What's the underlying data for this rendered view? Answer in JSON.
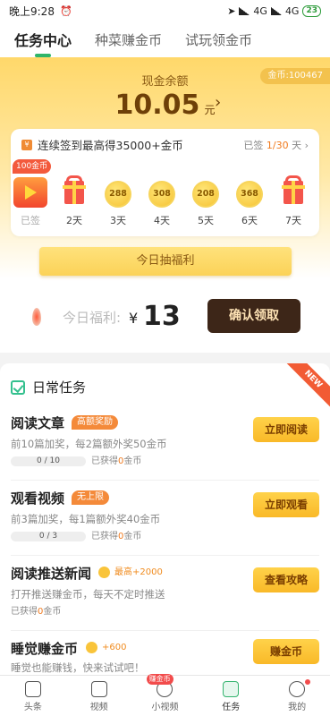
{
  "status_bar": {
    "time": "晚上9:28",
    "network": "4G",
    "network2": "4G",
    "battery": "23"
  },
  "top_tabs": [
    {
      "label": "任务中心",
      "active": true
    },
    {
      "label": "种菜赚金币",
      "active": false
    },
    {
      "label": "试玩领金币",
      "active": false
    }
  ],
  "hero": {
    "coin_tag": "金币:100467",
    "cash_label": "现金余额",
    "cash_value": "10.05",
    "cash_unit": "元"
  },
  "signin": {
    "title": "连续签到最高得35000+金币",
    "status_prefix": "已签",
    "status_count": "1/30",
    "status_suffix": "天 ›",
    "badge": "100金币",
    "days": [
      {
        "label": "已签",
        "reward": ""
      },
      {
        "label": "2天",
        "reward": ""
      },
      {
        "label": "3天",
        "reward": "288"
      },
      {
        "label": "4天",
        "reward": "308"
      },
      {
        "label": "5天",
        "reward": "208"
      },
      {
        "label": "6天",
        "reward": "368"
      },
      {
        "label": "7天",
        "reward": ""
      }
    ]
  },
  "lottery_button": "今日抽福利",
  "welfare": {
    "label": "今日福利:",
    "currency": "¥",
    "value": "13",
    "button": "确认领取"
  },
  "daily_tasks": {
    "title": "日常任务",
    "ribbon": "NEW",
    "items": [
      {
        "name": "阅读文章",
        "tag": "高额奖励",
        "desc": "前10篇加奖，每2篇额外奖50金币",
        "progress": "0 / 10",
        "earned_prefix": "已获得",
        "earned_value": "0",
        "earned_suffix": "金币",
        "action": "立即阅读"
      },
      {
        "name": "观看视频",
        "tag": "无上限",
        "desc": "前3篇加奖，每1篇额外奖40金币",
        "progress": "0 / 3",
        "earned_prefix": "已获得",
        "earned_value": "0",
        "earned_suffix": "金币",
        "action": "立即观看"
      },
      {
        "name": "阅读推送新闻",
        "tag": "最高+2000",
        "desc": "打开推送赚金币，每天不定时推送",
        "progress": "",
        "earned_prefix": "已获得",
        "earned_value": "0",
        "earned_suffix": "金币",
        "action": "查看攻略"
      },
      {
        "name": "睡觉赚金币",
        "tag": "+600",
        "desc": "睡觉也能赚钱，快来试试吧！",
        "progress": "",
        "earned_prefix": "",
        "earned_value": "",
        "earned_suffix": "",
        "action": "赚金币"
      }
    ]
  },
  "bottom_nav": [
    {
      "label": "头条",
      "icon": "news-icon"
    },
    {
      "label": "视频",
      "icon": "video-icon"
    },
    {
      "label": "小视频",
      "icon": "short-video-icon",
      "badge": "赚金币"
    },
    {
      "label": "任务",
      "icon": "task-icon",
      "active": true
    },
    {
      "label": "我的",
      "icon": "profile-icon"
    }
  ]
}
